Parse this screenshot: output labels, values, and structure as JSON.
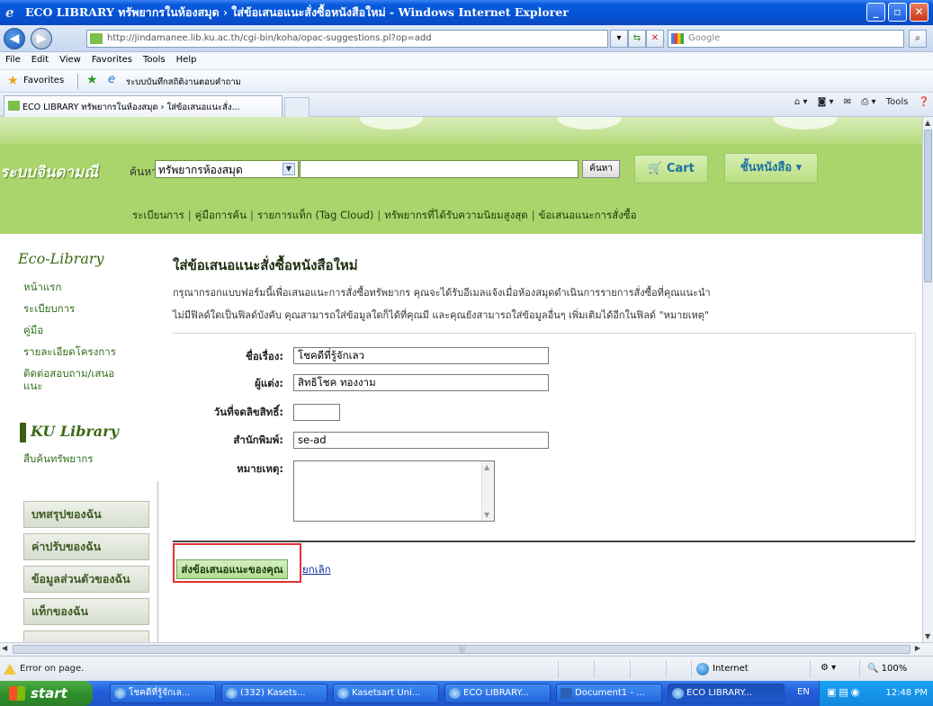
{
  "window": {
    "title": "ECO LIBRARY ทรัพยากรในห้องสมุด › ใส่ข้อเสนอแนะสั่งซื้อหนังสือใหม่ - Windows Internet Explorer",
    "minimize": "_",
    "maximize": "▫",
    "close": "✕"
  },
  "browser": {
    "url": "http://jindamanee.lib.ku.ac.th/cgi-bin/koha/opac-suggestions.pl?op=add",
    "search_placeholder": "Google",
    "menu": [
      "File",
      "Edit",
      "View",
      "Favorites",
      "Tools",
      "Help"
    ],
    "favorites_label": "Favorites",
    "favorites_link": "ระบบบันทึกสถิติงานตอบคำถาม",
    "tab_title": "ECO LIBRARY ทรัพยากรในห้องสมุด › ใส่ข้อเสนอแนะสั่ง...",
    "tools_label": "Tools"
  },
  "site_header": {
    "brand": "ระบบจินดามณี",
    "search_label": "ค้นหา",
    "search_scope": "ทรัพยากรห้องสมุด",
    "search_button": "ค้นหา",
    "cart_button": "Cart",
    "shelves_button": "ชั้นหนังสือ ▾",
    "links": [
      "ระเบียนการ",
      "คู่มือการค้น",
      "รายการแท็ก (Tag Cloud)",
      "ทรัพยากรที่ได้รับความนิยมสูงสุด",
      "ข้อเสนอแนะการสั่งซื้อ"
    ]
  },
  "sidebar": {
    "eco_heading": "Eco-Library",
    "eco_links": [
      "หน้าแรก",
      "ระเบียบการ",
      "คู่มือ",
      "รายละเอียดโครงการ",
      "ติดต่อสอบถาม/เสนอ",
      "แนะ"
    ],
    "ku_heading": "KU Library",
    "ku_links": [
      "สืบค้นทรัพยากร"
    ],
    "panels": [
      "บทสรุปของฉัน",
      "ค่าปรับของฉัน",
      "ข้อมูลส่วนตัวของฉัน",
      "แท็กของฉัน"
    ]
  },
  "form": {
    "title": "ใส่ข้อเสนอแนะสั่งซื้อหนังสือใหม่",
    "intro_1": "กรุณากรอกแบบฟอร์มนี้เพื่อเสนอแนะการสั่งซื้อทรัพยากร คุณจะได้รับอีเมลแจ้งเมื่อห้องสมุดดำเนินการรายการสั่งซื้อที่คุณแนะนำ",
    "intro_2": "ไม่มีฟิลด์ใดเป็นฟิลด์บังคับ คุณสามารถใส่ข้อมูลใดก็ได้ที่คุณมี และคุณยังสามารถใส่ข้อมูลอื่นๆ เพิ่มเติมได้อีกในฟิลด์ \"หมายเหตุ\"",
    "fields": {
      "title_label": "ชื่อเรื่อง:",
      "title_value": "โชคดีที่รู้จักเลว",
      "author_label": "ผู้แต่ง:",
      "author_value": "สิทธิโชค ทองงาม",
      "copyright_label": "วันที่จดลิขสิทธิ์:",
      "copyright_value": "",
      "publisher_label": "สำนักพิมพ์:",
      "publisher_value": "se-ad",
      "notes_label": "หมายเหตุ:",
      "notes_value": ""
    },
    "submit_button": "ส่งข้อเสนอแนะของคุณ",
    "cancel_link": "ยกเลิก"
  },
  "statusbar": {
    "message": "Error on page.",
    "zone": "Internet",
    "zoom": "🔍 100%"
  },
  "taskbar": {
    "start": "start",
    "tasks": [
      "โชคดีที่รู้จักเล...",
      "(332) Kasets...",
      "Kasetsart Uni...",
      "ECO LIBRARY...",
      "Document1 - ...",
      "ECO LIBRARY..."
    ],
    "language": "EN",
    "clock": "12:48 PM"
  },
  "colors": {
    "header_green": "#a9d56c",
    "link_green": "#2f6f1a",
    "highlight_red": "#e23232",
    "xp_blue": "#245edb"
  }
}
